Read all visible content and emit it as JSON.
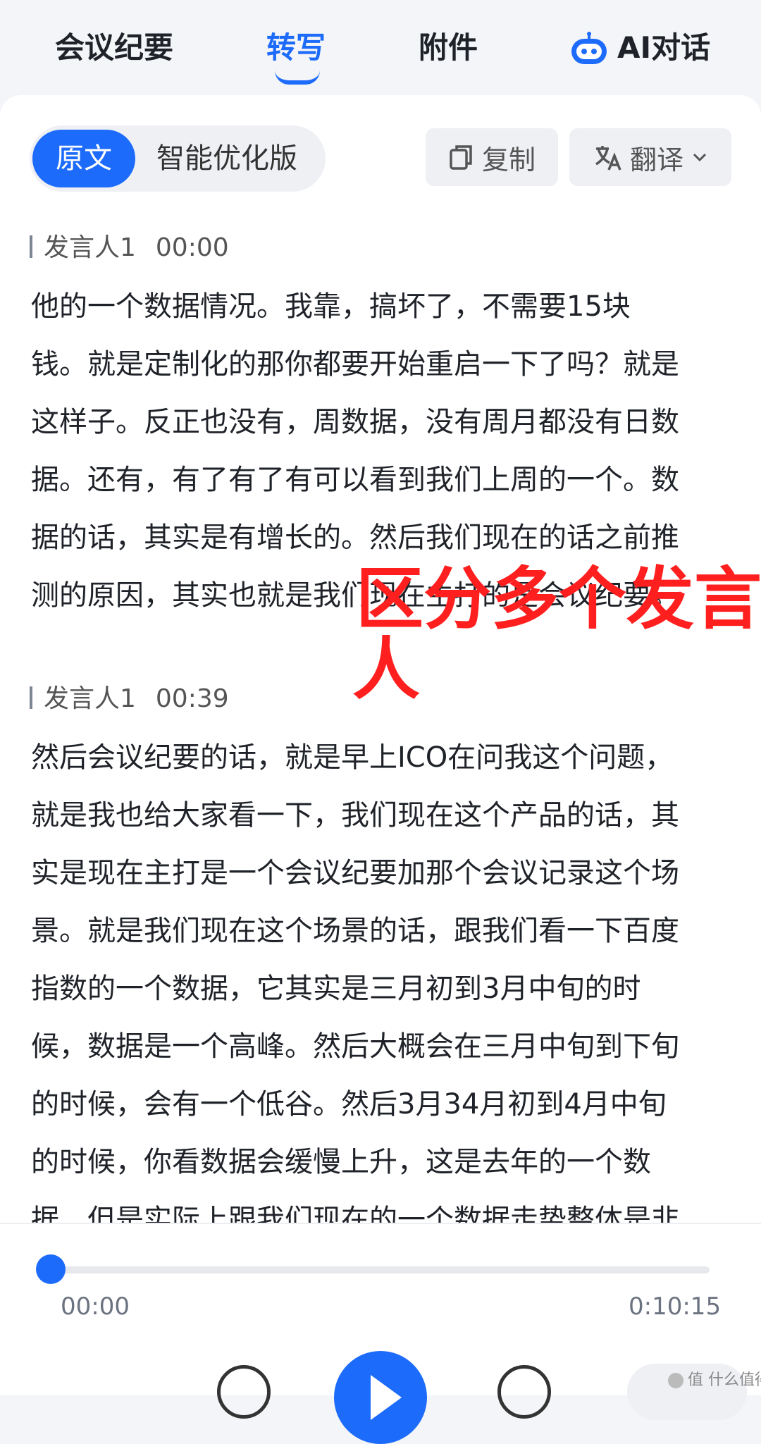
{
  "tabs": [
    {
      "label": "会议纪要"
    },
    {
      "label": "转写"
    },
    {
      "label": "附件"
    },
    {
      "label": "AI对话"
    }
  ],
  "toolbar": {
    "original_label": "原文",
    "optimized_label": "智能优化版",
    "copy_label": "复制",
    "translate_label": "翻译"
  },
  "segments": [
    {
      "speaker": "发言人1",
      "time": "00:00",
      "lines": [
        "他的一个数据情况。我靠，搞坏了，不需要15块",
        "钱。就是定制化的那你都要开始重启一下了吗？就是",
        "这样子。反正也没有，周数据，没有周月都没有日数",
        "据。还有，有了有了有可以看到我们上周的一个。数",
        "据的话，其实是有增长的。然后我们现在的话之前推",
        "测的原因，其实也就是我们现在主打的是会议纪要。"
      ]
    },
    {
      "speaker": "发言人1",
      "time": "00:39",
      "lines": [
        "然后会议纪要的话，就是早上ICO在问我这个问题，",
        "就是我也给大家看一下，我们现在这个产品的话，其",
        "实是现在主打是一个会议纪要加那个会议记录这个场",
        "景。就是我们现在这个场景的话，跟我们看一下百度",
        "指数的一个数据，它其实是三月初到3月中旬的时",
        "候，数据是一个高峰。然后大概会在三月中旬到下旬",
        "的时候，会有一个低谷。然后3月34月初到4月中旬",
        "的时候，你看数据会缓慢上升，这是去年的一个数",
        "据，但是实际上跟我们现在的一个数据走势整体是非"
      ]
    }
  ],
  "annotation": {
    "line1": "区分多个发言",
    "line2": "人"
  },
  "player": {
    "progress": 0.0,
    "current_time": "00:00",
    "total_time": "0:10:15"
  },
  "watermark": "值 什么值得买",
  "icons": {
    "ai": "robot-icon",
    "copy": "copy-icon",
    "translate": "translate-icon",
    "dropdown": "chevron-down-icon",
    "play": "play-icon",
    "rewind": "rewind-15-icon",
    "forward": "forward-15-icon"
  },
  "colors": {
    "accent": "#1d6bfa",
    "annotation": "#ff1f1f"
  }
}
